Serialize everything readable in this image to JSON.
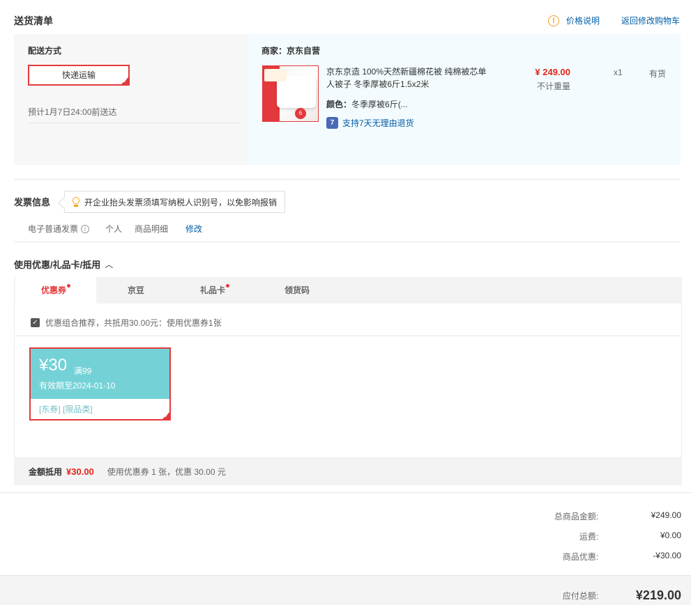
{
  "shipping": {
    "title": "送货清单",
    "price_note": "价格说明",
    "return_cart": "返回修改购物车",
    "method_label": "配送方式",
    "method_button": "快递运输",
    "eta": "预计1月7日24:00前送达",
    "merchant_label": "商家：",
    "merchant": "京东自营",
    "product": {
      "name": "京东京造 100%天然新疆棉花被 纯棉被芯单人被子 冬季厚被6斤1.5x2米",
      "color_label": "颜色：",
      "color": "冬季厚被6斤(...",
      "price": "¥ 249.00",
      "weight": "不计重量",
      "qty": "x1",
      "stock": "有货",
      "return_policy": "支持7天无理由退货",
      "return_icon": "7"
    }
  },
  "invoice": {
    "title": "发票信息",
    "tip": "开企业抬头发票须填写纳税人识别号，以免影响报销",
    "type": "电子普通发票",
    "type_help": "i",
    "person": "个人",
    "detail": "商品明细",
    "modify": "修改"
  },
  "coupon_section": {
    "title": "使用优惠/礼品卡/抵用",
    "tabs": [
      {
        "label": "优惠券",
        "dot": true
      },
      {
        "label": "京豆",
        "dot": false
      },
      {
        "label": "礼品卡",
        "dot": true
      },
      {
        "label": "领货码",
        "dot": false
      }
    ],
    "recommend": "优惠组合推荐，共抵用30.00元：使用优惠券1张",
    "coupon": {
      "amount": "¥30",
      "condition": "满99",
      "valid": "有效期至2024-01-10",
      "tags": "[东券]  [限品类]"
    },
    "deduct_label": "金额抵用",
    "deduct_amount": "¥30.00",
    "deduct_desc": "使用优惠券 1 张，优惠 30.00 元"
  },
  "summary": {
    "goods_label": "总商品金额:",
    "goods_value": "¥249.00",
    "freight_label": "运费:",
    "freight_value": "¥0.00",
    "discount_label": "商品优惠:",
    "discount_value": "-¥30.00",
    "total_label": "应付总额:",
    "total_value": "¥219.00"
  },
  "colors": {
    "accent_red": "#e4393c",
    "link_blue": "#005ea7",
    "coupon_teal": "#74d2d7"
  }
}
